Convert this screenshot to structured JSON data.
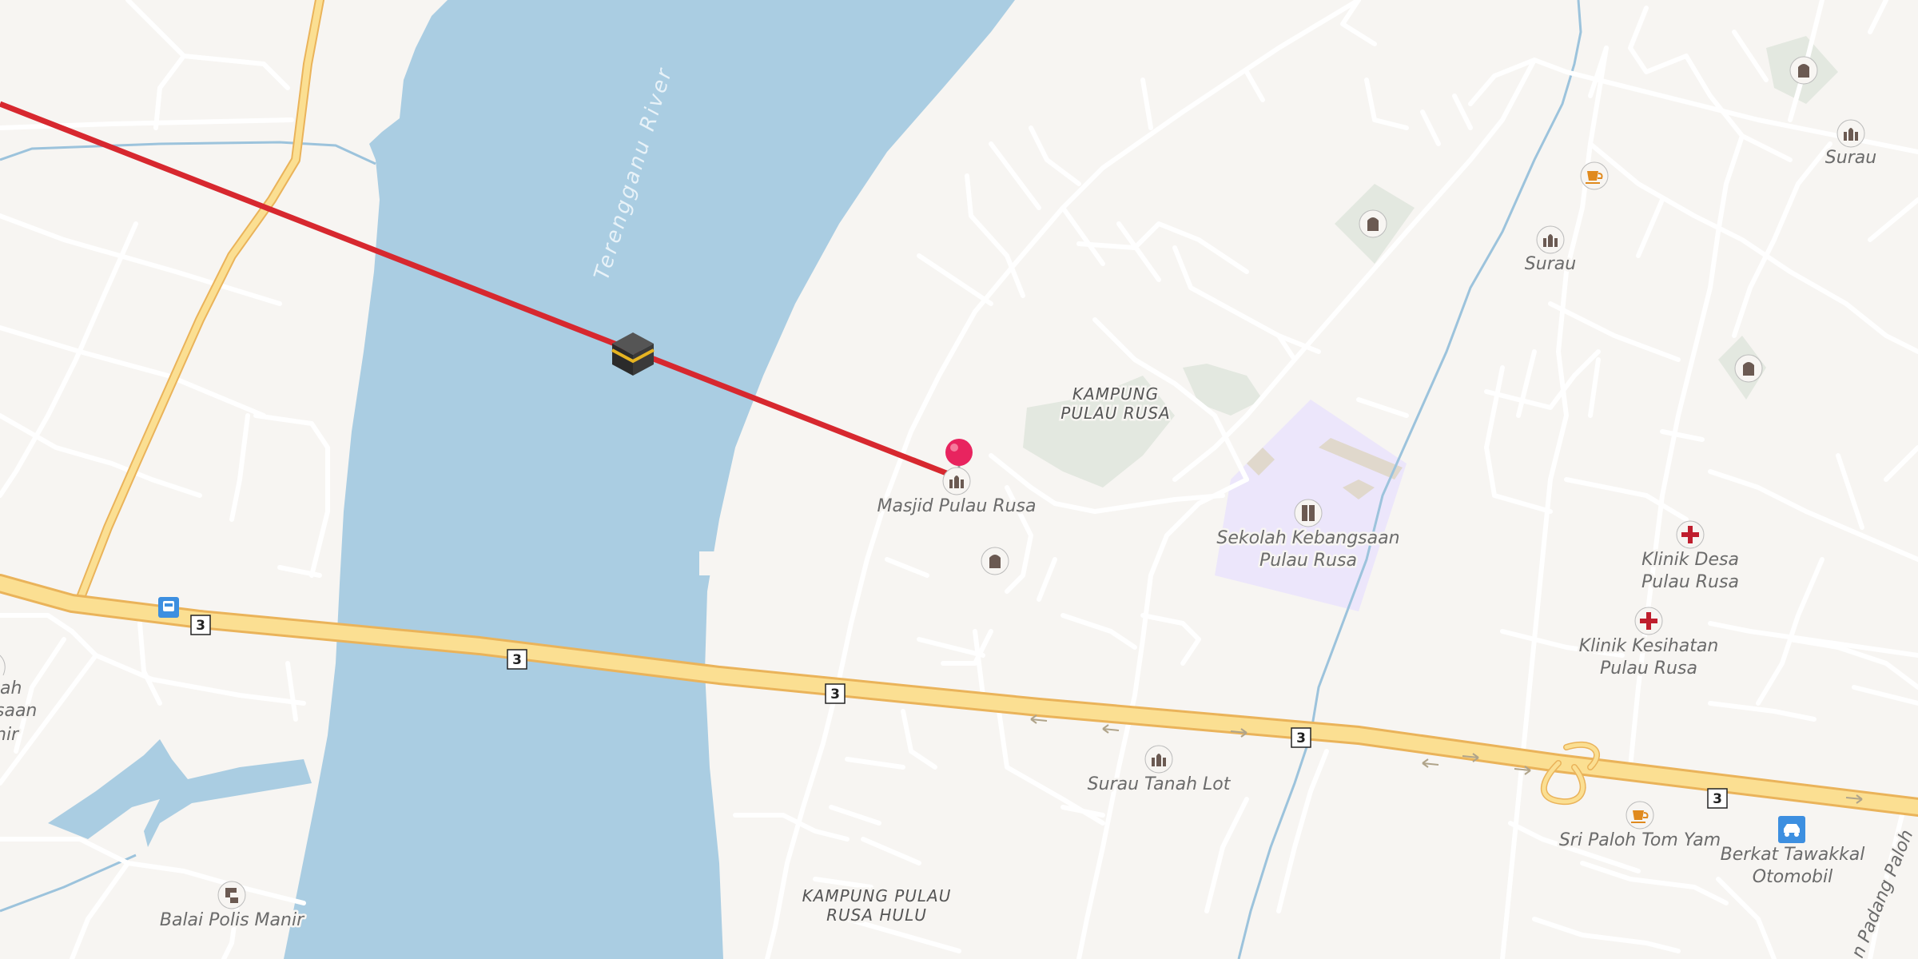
{
  "river": {
    "label": "Terengganu  River"
  },
  "areas": {
    "kampung_pulau_rusa": [
      "KAMPUNG",
      "PULAU RUSA"
    ],
    "kampung_pulau_rusa_hulu": [
      "KAMPUNG PULAU",
      "RUSA HULU"
    ]
  },
  "pois": {
    "masjid": "Masjid Pulau Rusa",
    "sekolah": [
      "Sekolah Kebangsaan",
      "Pulau Rusa"
    ],
    "surau_top": "Surau",
    "surau_mid": "Surau",
    "surau_tanah_lot": "Surau Tanah Lot",
    "klinik_desa": [
      "Klinik Desa",
      "Pulau Rusa"
    ],
    "klinik_kesihatan": [
      "Klinik Kesihatan",
      "Pulau Rusa"
    ],
    "sri_paloh": "Sri Paloh Tom Yam",
    "berkat": [
      "Berkat Tawakkal",
      "Otomobil"
    ],
    "balai_polis": "Balai Polis Manir",
    "cut_left": [
      "ah",
      "saan",
      "nir"
    ],
    "road_right": "n Padang Paloh"
  },
  "route": {
    "shield": "3"
  },
  "qibla": {
    "line_color": "#d7282f",
    "marker_icon": "kaaba-icon",
    "pin_color": "#e8245f"
  },
  "colors": {
    "water": "#aacde2",
    "land": "#f7f5f2",
    "road": "#ffffff",
    "highway": "#fbdf92",
    "highway_casing": "#eab35a"
  }
}
